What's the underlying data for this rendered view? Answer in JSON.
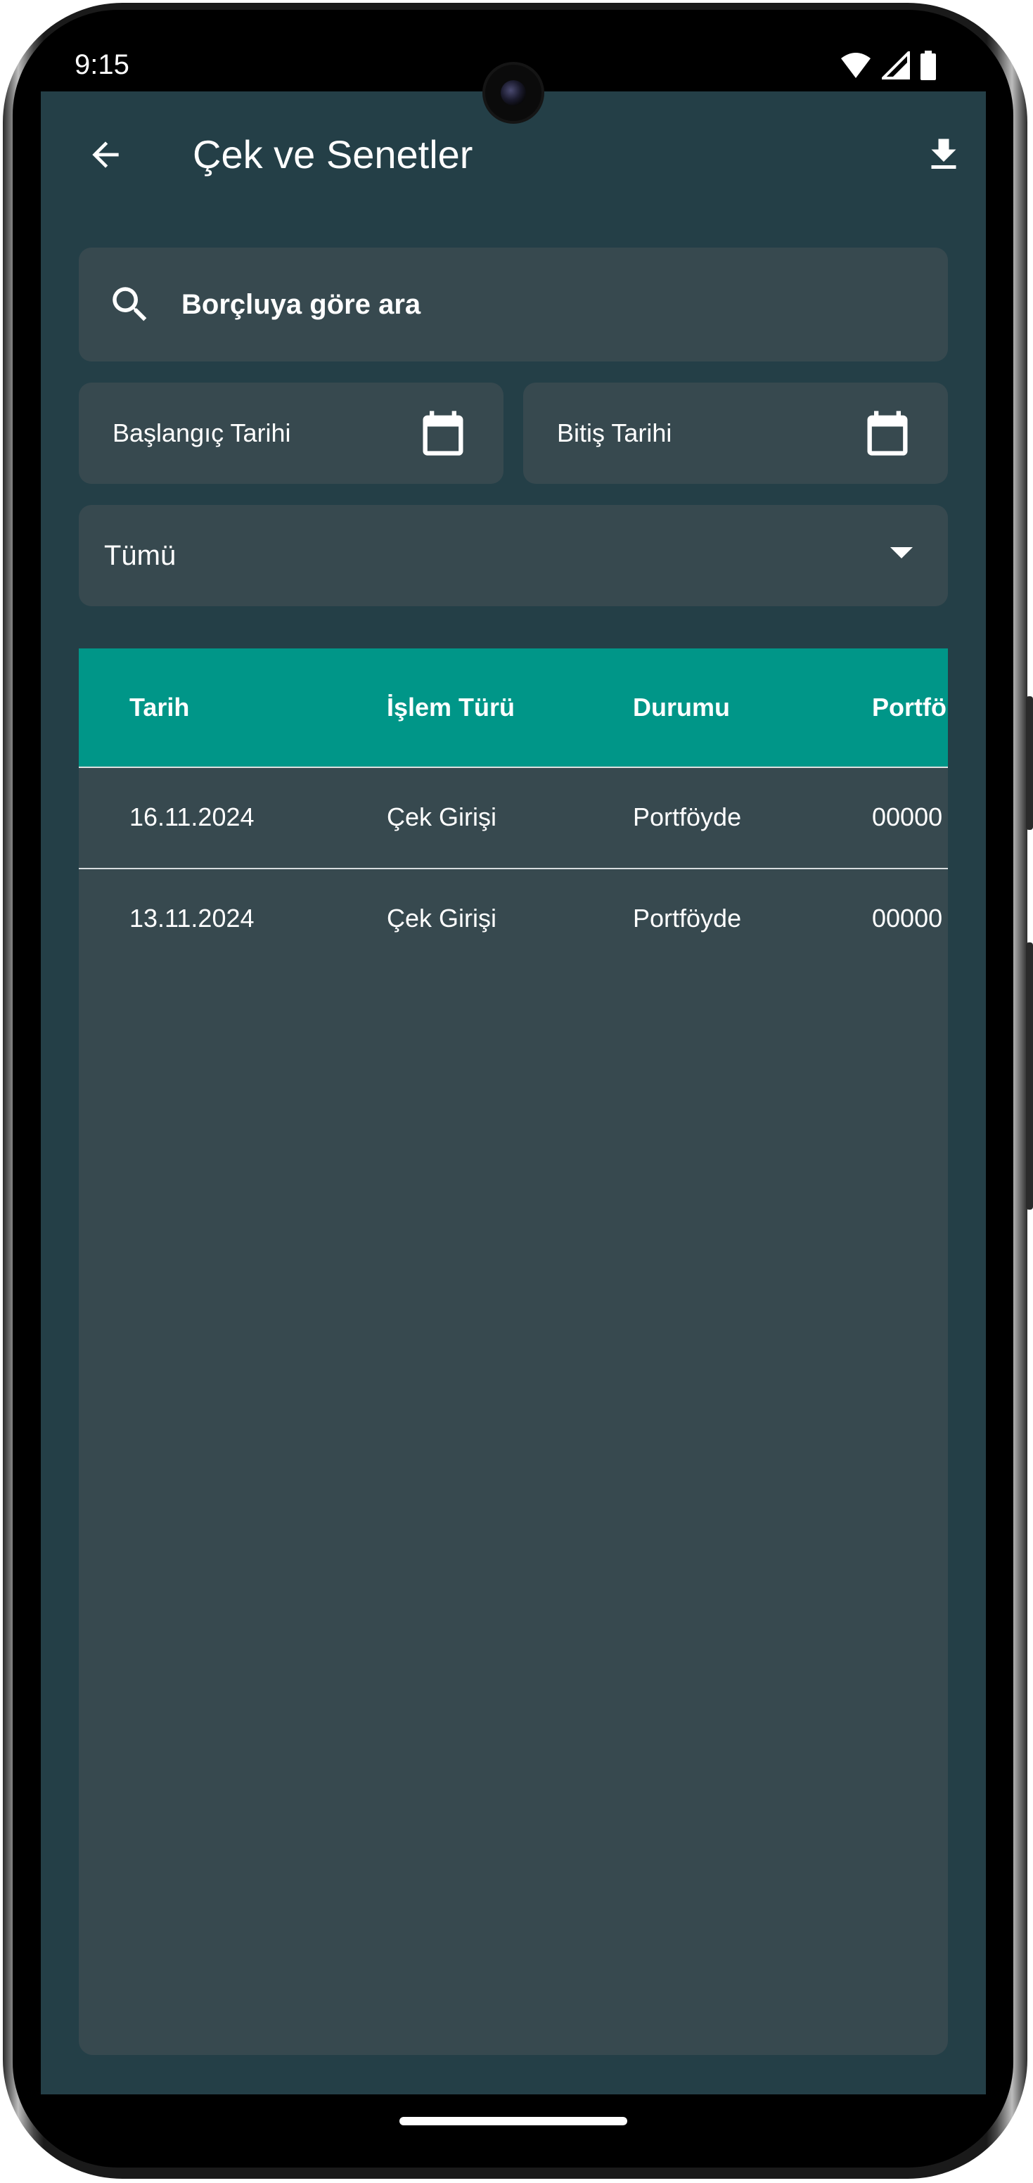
{
  "status_bar": {
    "time": "9:15",
    "icons": [
      "wifi-icon",
      "signal-icon",
      "battery-icon"
    ]
  },
  "app_bar": {
    "title": "Çek ve Senetler",
    "back_icon": "arrow-left-icon",
    "download_icon": "download-icon"
  },
  "search": {
    "placeholder": "Borçluya göre ara",
    "icon": "search-icon"
  },
  "date_filters": {
    "start_label": "Başlangıç Tarihi",
    "end_label": "Bitiş Tarihi",
    "icon": "calendar-icon"
  },
  "status_filter": {
    "selected": "Tümü"
  },
  "table": {
    "columns": [
      "Tarih",
      "İşlem Türü",
      "Durumu",
      "Portfö"
    ],
    "rows": [
      [
        "16.11.2024",
        "Çek Girişi",
        "Portföyde",
        "00000"
      ],
      [
        "13.11.2024",
        "Çek Girişi",
        "Portföyde",
        "00000"
      ]
    ]
  },
  "colors": {
    "background": "#243f47",
    "surface": "#37494f",
    "table_header": "#009688",
    "text": "#ffffff"
  }
}
